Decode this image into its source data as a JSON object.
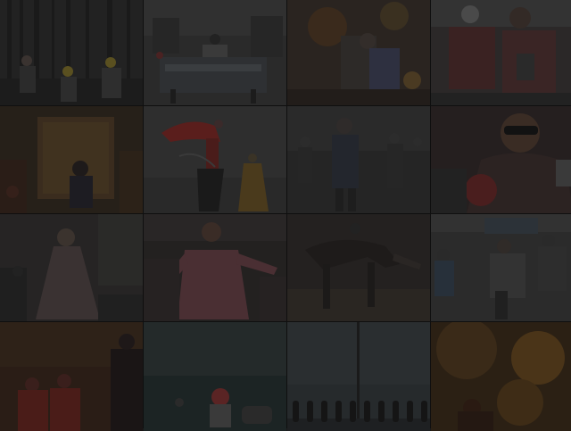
{
  "wall": {
    "columns": 4,
    "rows": 4,
    "dimmed": true,
    "tiles": [
      {
        "subject": "forest-workers",
        "base": "#242424"
      },
      {
        "subject": "street-vendor-cart",
        "base": "#2a2a2a"
      },
      {
        "subject": "lantern-crowd",
        "base": "#2b2520"
      },
      {
        "subject": "motorbike-riders",
        "base": "#2c2727"
      },
      {
        "subject": "seated-woman-room",
        "base": "#2a231c"
      },
      {
        "subject": "dancers-red-costume",
        "base": "#2f2f2f"
      },
      {
        "subject": "busy-street-walkers",
        "base": "#262626"
      },
      {
        "subject": "woman-sunglasses",
        "base": "#251f1f"
      },
      {
        "subject": "woman-white-dress",
        "base": "#262424"
      },
      {
        "subject": "man-pink-shirt",
        "base": "#262221"
      },
      {
        "subject": "horse-rider",
        "base": "#262220"
      },
      {
        "subject": "traffic-scooters",
        "base": "#2b2b2b"
      },
      {
        "subject": "red-umbrella-figures",
        "base": "#2a1d16"
      },
      {
        "subject": "child-red-hat-water",
        "base": "#1f2626"
      },
      {
        "subject": "streetlamp-bollards",
        "base": "#242729"
      },
      {
        "subject": "fire-smoke-figure",
        "base": "#2b2014"
      }
    ]
  }
}
